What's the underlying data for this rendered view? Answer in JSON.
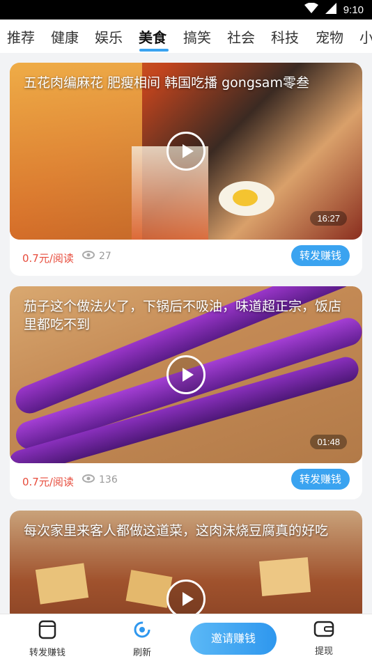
{
  "status_bar": {
    "time": "9:10"
  },
  "tabs": [
    {
      "label": "推荐"
    },
    {
      "label": "健康"
    },
    {
      "label": "娱乐"
    },
    {
      "label": "美食",
      "active": true
    },
    {
      "label": "搞笑"
    },
    {
      "label": "社会"
    },
    {
      "label": "科技"
    },
    {
      "label": "宠物"
    },
    {
      "label": "小"
    }
  ],
  "feed": [
    {
      "title": "五花肉编麻花 肥瘦相间 韩国吃播 gongsam零叁",
      "duration": "16:27",
      "price": "0.7元/阅读",
      "views": "27",
      "share_label": "转发赚钱"
    },
    {
      "title": "茄子这个做法火了，下锅后不吸油，味道超正宗，饭店里都吃不到",
      "duration": "01:48",
      "price": "0.7元/阅读",
      "views": "136",
      "share_label": "转发赚钱"
    },
    {
      "title": "每次家里来客人都做这道菜，这肉沫烧豆腐真的好吃",
      "duration": "",
      "price": "",
      "views": "",
      "share_label": ""
    }
  ],
  "bottom_nav": {
    "share": "转发赚钱",
    "refresh": "刷新",
    "invite": "邀请赚钱",
    "withdraw": "提现"
  },
  "colors": {
    "accent": "#3aa3f0",
    "price": "#e74c3c"
  }
}
